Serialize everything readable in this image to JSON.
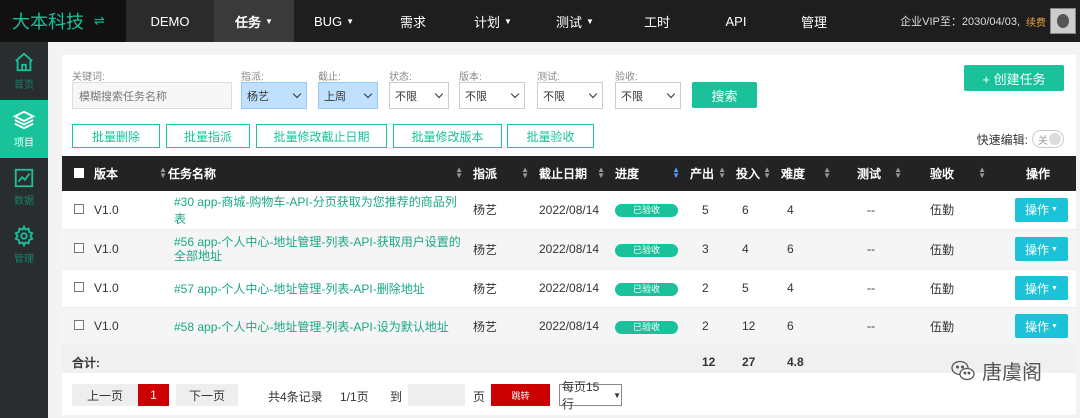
{
  "brand": {
    "name": "大本科技",
    "swap_icon": "swap-icon"
  },
  "project": "DEMO",
  "nav": [
    {
      "label": "任务",
      "caret": "▼",
      "active": true
    },
    {
      "label": "BUG",
      "caret": "▼"
    },
    {
      "label": "需求"
    },
    {
      "label": "计划",
      "caret": "▼"
    },
    {
      "label": "测试",
      "caret": "▼"
    },
    {
      "label": "工时"
    },
    {
      "label": "API"
    },
    {
      "label": "管理"
    }
  ],
  "vip": {
    "text": "企业VIP至：2030/04/03,",
    "renew": "续费"
  },
  "sidebar": [
    {
      "label": "首页",
      "icon": "home-icon"
    },
    {
      "label": "项目",
      "icon": "layers-icon",
      "active": true
    },
    {
      "label": "数据",
      "icon": "chart-icon"
    },
    {
      "label": "管理",
      "icon": "gear-icon"
    }
  ],
  "filters": {
    "keyword": {
      "label": "关键词:",
      "placeholder": "模糊搜索任务名称"
    },
    "assign": {
      "label": "指派:",
      "value": "杨艺"
    },
    "deadline": {
      "label": "截止:",
      "value": "上周"
    },
    "status": {
      "label": "状态:",
      "value": "不限"
    },
    "version": {
      "label": "版本:",
      "value": "不限"
    },
    "test": {
      "label": "测试:",
      "value": "不限"
    },
    "accept": {
      "label": "验收:",
      "value": "不限"
    },
    "search_button": "搜索",
    "create_button": "+ 创建任务"
  },
  "batch": [
    "批量删除",
    "批量指派",
    "批量修改截止日期",
    "批量修改版本",
    "批量验收"
  ],
  "quick_edit": {
    "label": "快速编辑:",
    "toggle": "关"
  },
  "table": {
    "headers": [
      "版本",
      "任务名称",
      "指派",
      "截止日期",
      "进度",
      "产出",
      "投入",
      "难度",
      "测试",
      "验收",
      "操作"
    ],
    "rows": [
      {
        "version": "V1.0",
        "name": "#30 app-商城-购物车-API-分页获取为您推荐的商品列表",
        "assign": "杨艺",
        "date": "2022/08/14",
        "progress": "已验收",
        "output": "5",
        "input": "6",
        "difficulty": "4",
        "test": "--",
        "accept": "伍勤",
        "op": "操作"
      },
      {
        "version": "V1.0",
        "name": "#56 app-个人中心-地址管理-列表-API-获取用户设置的全部地址",
        "assign": "杨艺",
        "date": "2022/08/14",
        "progress": "已验收",
        "output": "3",
        "input": "4",
        "difficulty": "6",
        "test": "--",
        "accept": "伍勤",
        "op": "操作"
      },
      {
        "version": "V1.0",
        "name": "#57 app-个人中心-地址管理-列表-API-删除地址",
        "assign": "杨艺",
        "date": "2022/08/14",
        "progress": "已验收",
        "output": "2",
        "input": "5",
        "difficulty": "4",
        "test": "--",
        "accept": "伍勤",
        "op": "操作"
      },
      {
        "version": "V1.0",
        "name": "#58 app-个人中心-地址管理-列表-API-设为默认地址",
        "assign": "杨艺",
        "date": "2022/08/14",
        "progress": "已验收",
        "output": "2",
        "input": "12",
        "difficulty": "6",
        "test": "--",
        "accept": "伍勤",
        "op": "操作"
      }
    ],
    "total": {
      "label": "合计:",
      "output": "12",
      "input": "27",
      "difficulty": "4.8"
    }
  },
  "pager": {
    "prev": "上一页",
    "current": "1",
    "next": "下一页",
    "records": "共4条记录",
    "pages": "1/1页",
    "goto": "到",
    "page_unit": "页",
    "jump": "跳转",
    "page_size": "每页15行"
  },
  "watermark": "唐虞阁"
}
